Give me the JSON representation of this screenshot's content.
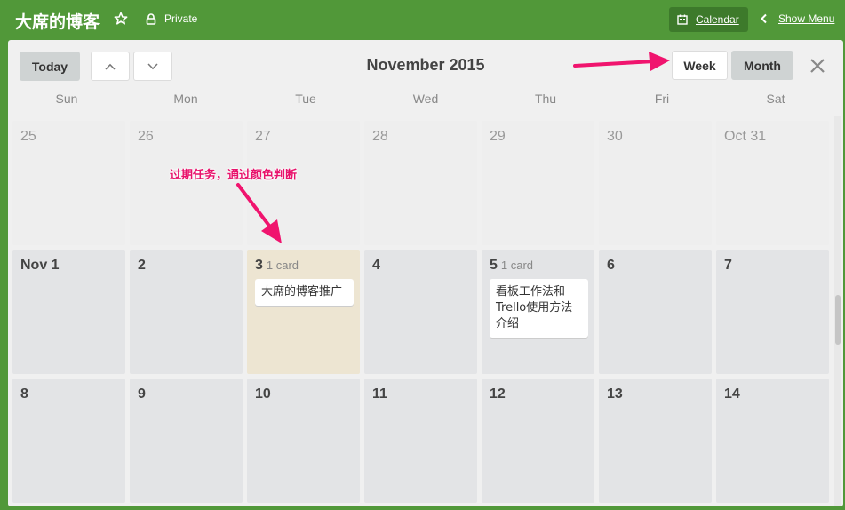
{
  "header": {
    "board_title": "大席的博客",
    "privacy_label": "Private",
    "calendar_label": "Calendar",
    "show_menu_label": "Show Menu"
  },
  "toolbar": {
    "today_label": "Today",
    "month_title": "November 2015",
    "week_label": "Week",
    "month_label": "Month"
  },
  "weekdays": [
    "Sun",
    "Mon",
    "Tue",
    "Wed",
    "Thu",
    "Fri",
    "Sat"
  ],
  "weeks": [
    [
      {
        "label": "25",
        "faded": true
      },
      {
        "label": "26",
        "faded": true
      },
      {
        "label": "27",
        "faded": true
      },
      {
        "label": "28",
        "faded": true
      },
      {
        "label": "29",
        "faded": true
      },
      {
        "label": "30",
        "faded": true
      },
      {
        "label": "Oct 31",
        "faded": true
      }
    ],
    [
      {
        "label": "Nov 1"
      },
      {
        "label": "2"
      },
      {
        "label": "3",
        "count": "1 card",
        "overdue": true,
        "cards": [
          "大席的博客推广"
        ]
      },
      {
        "label": "4"
      },
      {
        "label": "5",
        "count": "1 card",
        "cards": [
          "看板工作法和Trello使用方法介绍"
        ]
      },
      {
        "label": "6"
      },
      {
        "label": "7"
      }
    ],
    [
      {
        "label": "8"
      },
      {
        "label": "9"
      },
      {
        "label": "10"
      },
      {
        "label": "11"
      },
      {
        "label": "12"
      },
      {
        "label": "13"
      },
      {
        "label": "14"
      }
    ]
  ],
  "annotation": {
    "text": "过期任务，通过颜色判断"
  },
  "colors": {
    "board_green": "#519839",
    "overdue_cell": "#ede5d2",
    "annotation_pink": "#e8126b"
  }
}
